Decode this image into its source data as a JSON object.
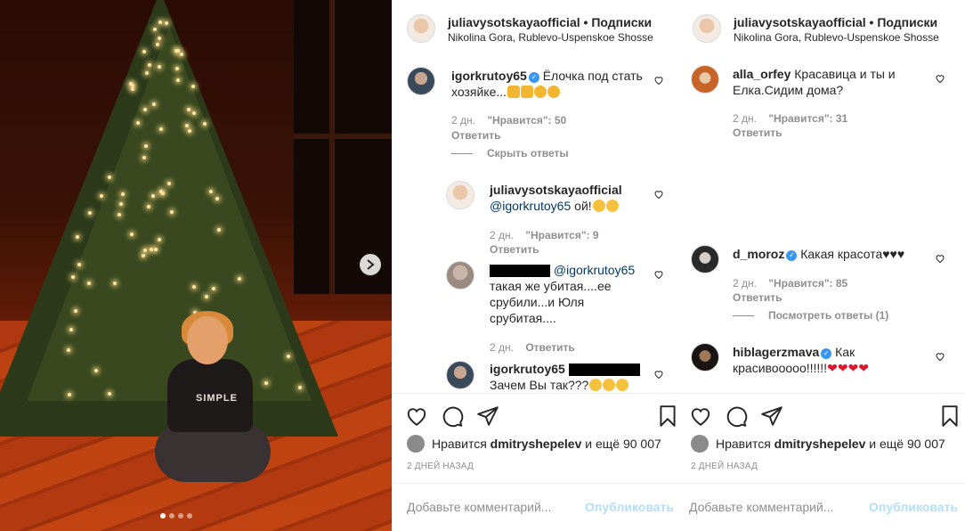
{
  "photo": {
    "carousel_dots": 4,
    "active_dot": 0,
    "shirt_print": "SIMPLE"
  },
  "post": {
    "author": "juliavysotskayaofficial",
    "follow_label": "• Подписки",
    "location": "Nikolina Gora, Rublevo-Uspenskoe Shosse",
    "likes_prefix": "Нравится",
    "likes_user": "dmitryshepelev",
    "likes_suffix": "и ещё 90 007",
    "date": "2 ДНЕЙ НАЗАД",
    "comment_placeholder": "Добавьте комментарий...",
    "publish_label": "Опубликовать"
  },
  "left_comments": {
    "c1": {
      "user": "igorkrutoy65",
      "text": "Ёлочка под стать хозяйке...",
      "time": "2 дн.",
      "likes": "\"Нравится\": 50",
      "reply": "Ответить"
    },
    "hide_replies": "Скрыть ответы",
    "r1": {
      "user": "juliavysotskayaofficial",
      "mention": "@igorkrutoy65",
      "text": "ой!",
      "time": "2 дн.",
      "likes": "\"Нравится\": 9",
      "reply": "Ответить"
    },
    "r2": {
      "mention": "@igorkrutoy65",
      "text": "такая же убитая....ее срубили...и Юля срубитая....",
      "time": "2 дн.",
      "reply": "Ответить"
    },
    "r3": {
      "user": "igorkrutoy65",
      "text": "Зачем Вы так???"
    }
  },
  "right_comments": {
    "c1": {
      "user": "alla_orfey",
      "text": "Красавица и ты и Елка.Сидим дома?",
      "time": "2 дн.",
      "likes": "\"Нравится\": 31",
      "reply": "Ответить"
    },
    "c2": {
      "user": "d_moroz",
      "text": "Какая красота♥♥♥",
      "time": "2 дн.",
      "likes": "\"Нравится\": 85",
      "reply": "Ответить",
      "view_replies": "Посмотреть ответы (1)"
    },
    "c3": {
      "user": "hiblagerzmava",
      "text": "Как красивооооо!!!!!!"
    }
  },
  "colors": {
    "verified": "#3897f0",
    "publish_disabled": "#b2dffc",
    "muted": "#8e8e8e",
    "heart": "#e0142c"
  }
}
